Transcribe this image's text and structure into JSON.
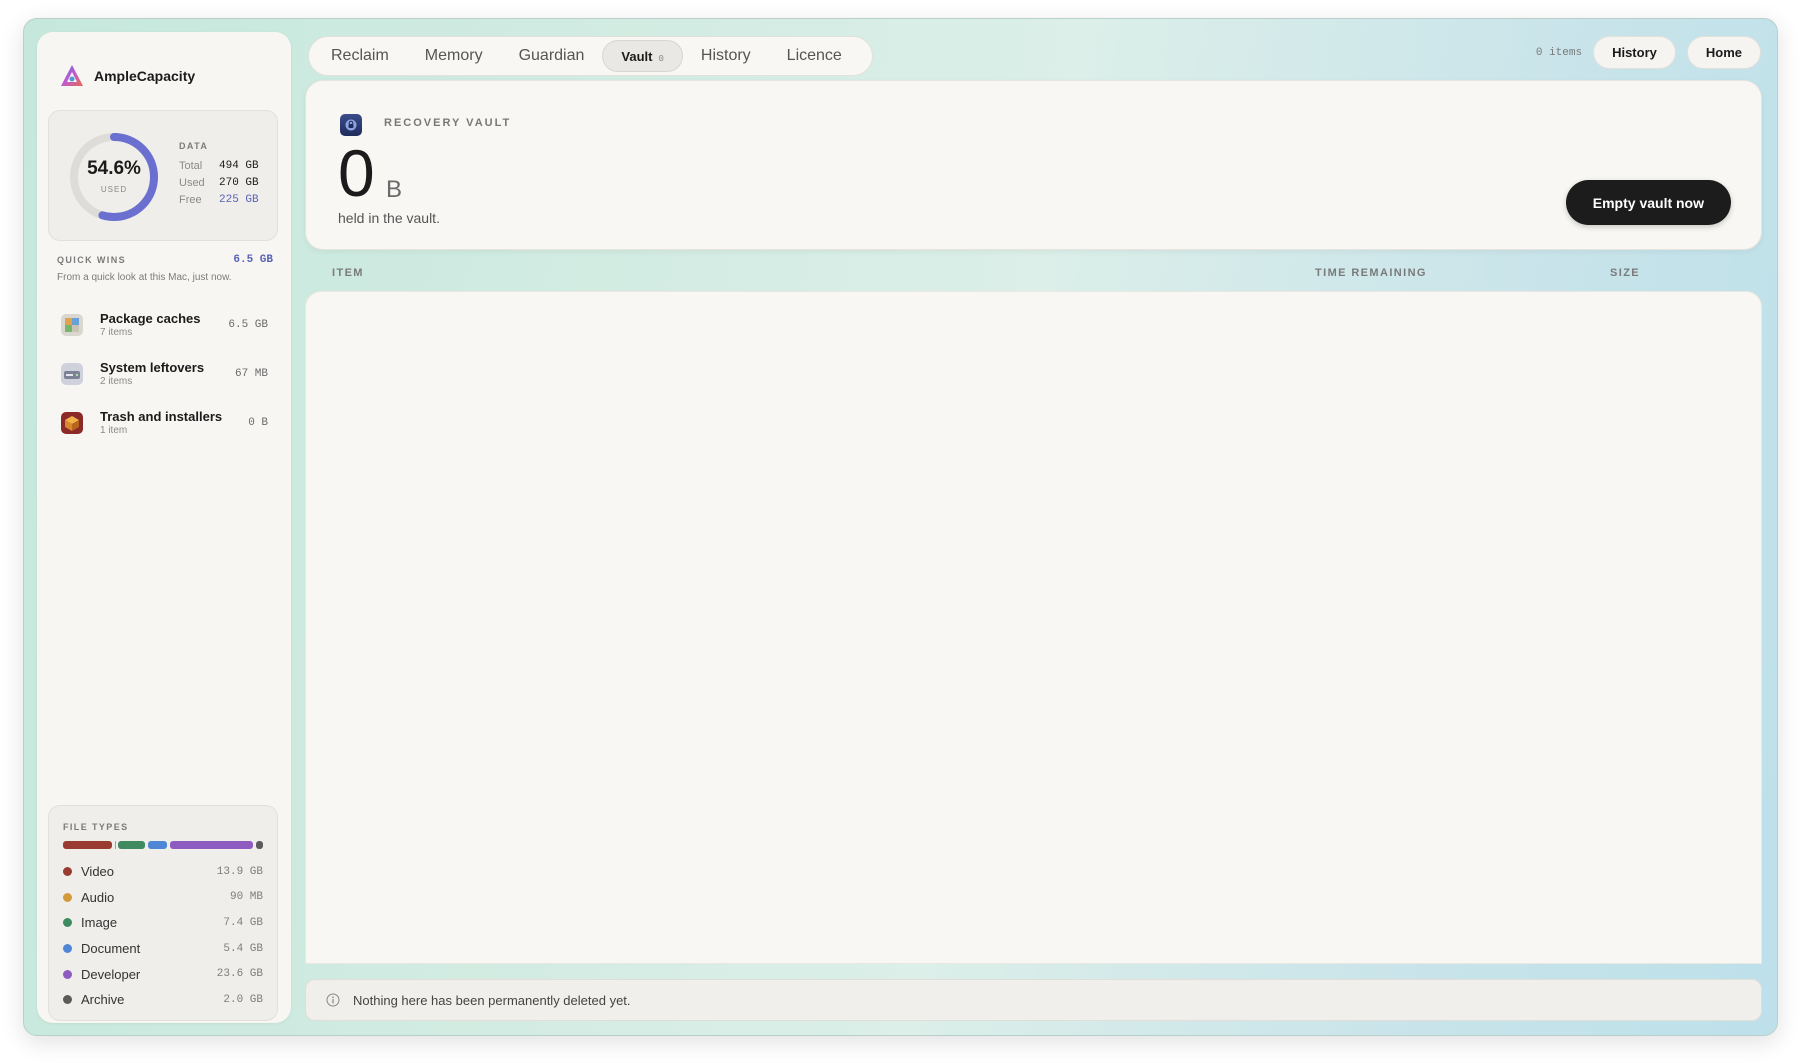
{
  "app": {
    "name": "AmpleCapacity"
  },
  "disk": {
    "used_percent": "54.6%",
    "used_fraction": 0.546,
    "used_label": "USED",
    "heading": "DATA",
    "rows": [
      {
        "key": "Total",
        "value": "494 GB"
      },
      {
        "key": "Used",
        "value": "270 GB"
      },
      {
        "key": "Free",
        "value": "225 GB"
      }
    ],
    "ring_color": "#6b6fd0"
  },
  "quick_wins": {
    "title": "QUICK WINS",
    "total": "6.5 GB",
    "description": "From a quick look at this Mac, just now.",
    "items": [
      {
        "name": "Package caches",
        "count": "7 items",
        "size": "6.5 GB",
        "icon": "package-icon"
      },
      {
        "name": "System leftovers",
        "count": "2 items",
        "size": "67 MB",
        "icon": "drive-icon"
      },
      {
        "name": "Trash and installers",
        "count": "1 item",
        "size": "0 B",
        "icon": "trash-icon"
      }
    ]
  },
  "file_types": {
    "title": "FILE TYPES",
    "items": [
      {
        "name": "Video",
        "size": "13.9 GB",
        "color": "#9a3b32"
      },
      {
        "name": "Audio",
        "size": "90 MB",
        "color": "#d29a3a"
      },
      {
        "name": "Image",
        "size": "7.4 GB",
        "color": "#3f8a5f"
      },
      {
        "name": "Document",
        "size": "5.4 GB",
        "color": "#4f86d6"
      },
      {
        "name": "Developer",
        "size": "23.6 GB",
        "color": "#8e5bc0"
      },
      {
        "name": "Archive",
        "size": "2.0 GB",
        "color": "#5b5b5b"
      }
    ]
  },
  "tabs": [
    {
      "label": "Reclaim"
    },
    {
      "label": "Memory"
    },
    {
      "label": "Guardian"
    },
    {
      "label": "Vault",
      "badge": "0",
      "active": true
    },
    {
      "label": "History"
    },
    {
      "label": "Licence"
    }
  ],
  "top_right": {
    "items_count": "0 items",
    "history_label": "History",
    "home_label": "Home"
  },
  "vault": {
    "label": "RECOVERY VAULT",
    "amount": "0",
    "unit": "B",
    "subtitle": "held in the vault.",
    "empty_button": "Empty vault now"
  },
  "table": {
    "columns": [
      "ITEM",
      "TIME REMAINING",
      "SIZE"
    ],
    "rows": []
  },
  "footer": {
    "message": "Nothing here has been permanently deleted yet."
  }
}
